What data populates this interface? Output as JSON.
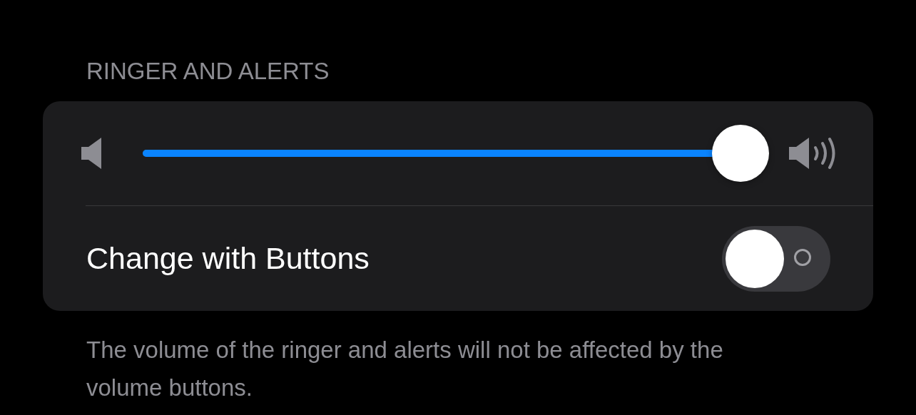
{
  "section_header": "RINGER AND ALERTS",
  "volume_slider": {
    "level": 0.97
  },
  "change_with_buttons": {
    "label": "Change with Buttons",
    "on": false
  },
  "footer": "The volume of the ringer and alerts will not be affected by the volume buttons."
}
